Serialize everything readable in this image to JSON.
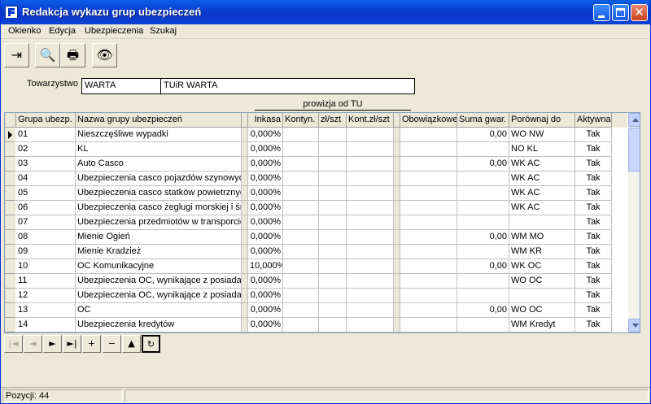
{
  "window": {
    "title": "Redakcja wykazu grup ubezpieczeń"
  },
  "menu": [
    "Okienko",
    "Edycja",
    "Ubezpieczenia",
    "Szukaj"
  ],
  "toolbar": {
    "buttons": [
      {
        "name": "exit-icon",
        "glyph": "⇥"
      },
      {
        "name": "preview-icon",
        "glyph": "🔍"
      },
      {
        "name": "print-icon",
        "glyph": "🖶"
      },
      {
        "name": "binoculars-icon",
        "glyph": "👁"
      }
    ]
  },
  "form": {
    "towarzystwo_label": "Towarzystwo",
    "code": "WARTA",
    "name": "TUiR WARTA"
  },
  "grid": {
    "group_header": "prowizja od TU",
    "columns": [
      "Grupa ubezp.",
      "Nazwa grupy ubezpieczeń",
      "Inkasa",
      "Kontyn.",
      "zł/szt",
      "Kont.zł/szt",
      "Obowiązkowe",
      "Suma gwar.",
      "Porównaj do",
      "Aktywna"
    ],
    "rows": [
      {
        "grupa": "01",
        "nazwa": "Nieszczęśliwe wypadki",
        "inkasa": "0,000%",
        "suma": "0,00",
        "porownaj": "WO NW",
        "aktywna": "Tak"
      },
      {
        "grupa": "02",
        "nazwa": "KL",
        "inkasa": "0,000%",
        "suma": "",
        "porownaj": "NO KL",
        "aktywna": "Tak"
      },
      {
        "grupa": "03",
        "nazwa": "Auto Casco",
        "inkasa": "0,000%",
        "suma": "0,00",
        "porownaj": "WK AC",
        "aktywna": "Tak"
      },
      {
        "grupa": "04",
        "nazwa": "Ubezpieczenia casco pojazdów szynowych",
        "inkasa": "0,000%",
        "suma": "",
        "porownaj": "WK AC",
        "aktywna": "Tak"
      },
      {
        "grupa": "05",
        "nazwa": "Ubezpieczenia casco statków powietrznych",
        "inkasa": "0,000%",
        "suma": "",
        "porownaj": "WK AC",
        "aktywna": "Tak"
      },
      {
        "grupa": "06",
        "nazwa": "Ubezpieczenia casco żeglugi morskiej i śródlądowej",
        "inkasa": "0,000%",
        "suma": "",
        "porownaj": "WK AC",
        "aktywna": "Tak"
      },
      {
        "grupa": "07",
        "nazwa": "Ubezpieczenia przedmiotów w transporcie",
        "inkasa": "0,000%",
        "suma": "",
        "porownaj": "",
        "aktywna": "Tak"
      },
      {
        "grupa": "08",
        "nazwa": "Mienie Ogień",
        "inkasa": "0,000%",
        "suma": "0,00",
        "porownaj": "WM MO",
        "aktywna": "Tak"
      },
      {
        "grupa": "09",
        "nazwa": "Mienie Kradzież",
        "inkasa": "0,000%",
        "suma": "",
        "porownaj": "WM KR",
        "aktywna": "Tak"
      },
      {
        "grupa": "10",
        "nazwa": "OC Komunikacyjne",
        "inkasa": "10,000%",
        "suma": "0,00",
        "porownaj": "WK OC",
        "aktywna": "Tak"
      },
      {
        "grupa": "11",
        "nazwa": "Ubezpieczenia  OC, wynikające z posiadania",
        "inkasa": "0,000%",
        "suma": "",
        "porownaj": "WO OC",
        "aktywna": "Tak"
      },
      {
        "grupa": "12",
        "nazwa": "Ubezpieczenia  OC,  wynikające z posiadania",
        "inkasa": "0,000%",
        "suma": "",
        "porownaj": "",
        "aktywna": "Tak"
      },
      {
        "grupa": "13",
        "nazwa": "OC",
        "inkasa": "0,000%",
        "suma": "0,00",
        "porownaj": "WO OC",
        "aktywna": "Tak"
      },
      {
        "grupa": "14",
        "nazwa": "Ubezpieczenia kredytów",
        "inkasa": "0,000%",
        "suma": "",
        "porownaj": "WM Kredyt",
        "aktywna": "Tak"
      }
    ]
  },
  "navigator": {
    "buttons": [
      {
        "name": "first-record-icon",
        "glyph": "|◄",
        "disabled": true
      },
      {
        "name": "prior-record-icon",
        "glyph": "◄",
        "disabled": true
      },
      {
        "name": "next-record-icon",
        "glyph": "►",
        "disabled": false
      },
      {
        "name": "last-record-icon",
        "glyph": "►|",
        "disabled": false
      },
      {
        "name": "insert-record-icon",
        "glyph": "+",
        "disabled": false
      },
      {
        "name": "delete-record-icon",
        "glyph": "−",
        "disabled": false
      },
      {
        "name": "edit-record-icon",
        "glyph": "▲",
        "disabled": false
      },
      {
        "name": "refresh-icon",
        "glyph": "↻",
        "disabled": false
      }
    ]
  },
  "status": {
    "text": "Pozycji: 44"
  }
}
